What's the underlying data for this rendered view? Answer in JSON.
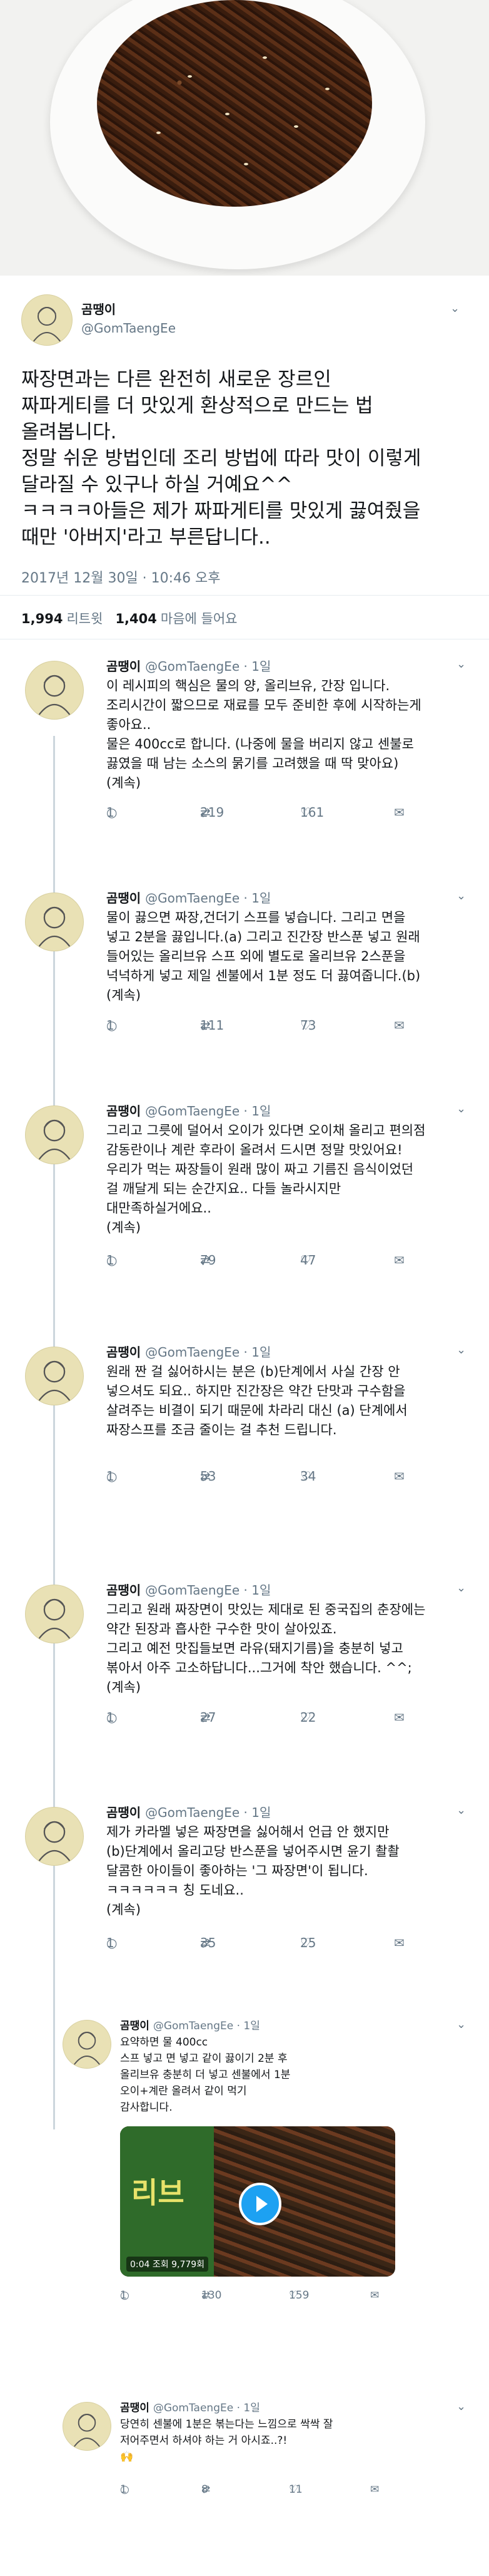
{
  "tweet": {
    "author_name": "곰땡이",
    "author_handle": "@GomTaengEe",
    "text_lines": [
      "짜장면과는 다른 완전히 새로운 장르인",
      "짜파게티를 더 맛있게 환상적으로 만드는 법",
      "올려봅니다.",
      "정말 쉬운 방법인데 조리 방법에 따라 맛이 이렇게",
      "달라질 수 있구나 하실 거예요^^",
      "ㅋㅋㅋㅋ아들은 제가 짜파게티를 맛있게 끓여줬을",
      "때만 '아버지'라고 부른답니다.."
    ],
    "date": "2017년 12월 30일 · 10:46 오후",
    "retweets": "1,994",
    "retweets_label": "리트윗",
    "likes": "1,404",
    "likes_label": "마음에 들어요"
  },
  "replies": [
    {
      "name": "곰땡이",
      "meta": "@GomTaengEe · 1일",
      "lines": [
        "이 레시피의 핵심은 물의 양, 올리브유, 간장 입니다.",
        "조리시간이 짧으므로 재료를 모두 준비한 후에 시작하는게",
        "좋아요..",
        "물은 400cc로 합니다. (나중에 물을 버리지 않고 센불로",
        "끓였을 때 남는 소스의 묽기를 고려했을 때 딱 맞아요)",
        "(계속)"
      ],
      "comments": "1",
      "retweets": "219",
      "likes": "161"
    },
    {
      "name": "곰땡이",
      "meta": "@GomTaengEe · 1일",
      "lines": [
        "물이 끓으면 짜장,건더기 스프를 넣습니다. 그리고 면을",
        "넣고 2분을 끓입니다.(a) 그리고 진간장 반스푼 넣고 원래",
        "들어있는 올리브유 스프 외에 별도로 올리브유 2스푼을",
        "넉넉하게 넣고 제일 센불에서 1분 정도 더 끓여줍니다.(b)",
        "(계속)"
      ],
      "comments": "1",
      "retweets": "111",
      "likes": "73"
    },
    {
      "name": "곰땡이",
      "meta": "@GomTaengEe · 1일",
      "lines": [
        "그리고 그릇에 덜어서 오이가 있다면 오이채 올리고 편의점",
        "감동란이나 계란 후라이 올려서 드시면 정말 맛있어요!",
        "우리가 먹는 짜장들이 원래 많이 짜고 기름진 음식이었던",
        "걸 깨달게 되는 순간지요.. 다들 놀라시지만",
        "대만족하실거에요..",
        "(계속)"
      ],
      "comments": "1",
      "retweets": "79",
      "likes": "47"
    },
    {
      "name": "곰땡이",
      "meta": "@GomTaengEe · 1일",
      "lines": [
        "원래 짠 걸 싫어하시는 분은 (b)단계에서 사실 간장 안",
        "넣으셔도 되요.. 하지만 진간장은 약간 단맛과 구수함을",
        "살려주는 비결이 되기 때문에 차라리 대신 (a) 단계에서",
        "짜장스프를 조금 줄이는 걸 추천 드립니다."
      ],
      "comments": "1",
      "retweets": "53",
      "likes": "34"
    },
    {
      "name": "곰땡이",
      "meta": "@GomTaengEe · 1일",
      "lines": [
        "그리고 원래 짜장면이 맛있는 제대로 된 중국집의 춘장에는",
        "약간 된장과 흡사한 구수한 맛이 살아있죠.",
        "그리고 예전 맛집들보면 라유(돼지기름)을 충분히 넣고",
        "볶아서 아주 고소하답니다...그거에 착안 했습니다. ^^;",
        "(계속)"
      ],
      "comments": "1",
      "retweets": "27",
      "likes": "22"
    },
    {
      "name": "곰땡이",
      "meta": "@GomTaengEe · 1일",
      "lines": [
        "제가 카라멜 넣은 짜장면을 싫어해서 언급 안 했지만",
        "(b)단계에서 올리고당 반스푼을 넣어주시면 윤기 촬촬",
        "달콤한 아이들이 좋아하는 '그 짜장면'이 됩니다.",
        "ㅋㅋㅋㅋㅋㅋ 칭 도네요..",
        "(계속)"
      ],
      "comments": "1",
      "retweets": "35",
      "likes": "25"
    }
  ],
  "nested": [
    {
      "name": "곰땡이",
      "meta": "@GomTaengEe · 1일",
      "lines": [
        "요약하면 물 400cc",
        "스프 넣고 면 넣고 같이 끓이기 2분 후",
        "올리브유 충분히 더 넣고 센불에서 1분",
        "오이+계란 올려서 같이 먹기",
        "감사합니다."
      ],
      "video_meta": "0:04  조회 9,779회",
      "pack_text": "리브",
      "comments": "1",
      "retweets": "130",
      "likes": "159"
    },
    {
      "name": "곰땡이",
      "meta": "@GomTaengEe · 1일",
      "lines": [
        "당연히 센불에 1분은 볶는다는 느낌으로 싹싹 잘",
        "저어주면서 하셔야 하는 거 아시죠..?!",
        "🙌"
      ],
      "comments": "1",
      "retweets": "8",
      "likes": "11"
    }
  ],
  "icons": {
    "comment": "○",
    "retweet": "⇄",
    "like": "♡",
    "mail": "✉",
    "chevron": "⌄"
  },
  "colors": {
    "accent": "#1da1f2",
    "muted": "#657786"
  }
}
